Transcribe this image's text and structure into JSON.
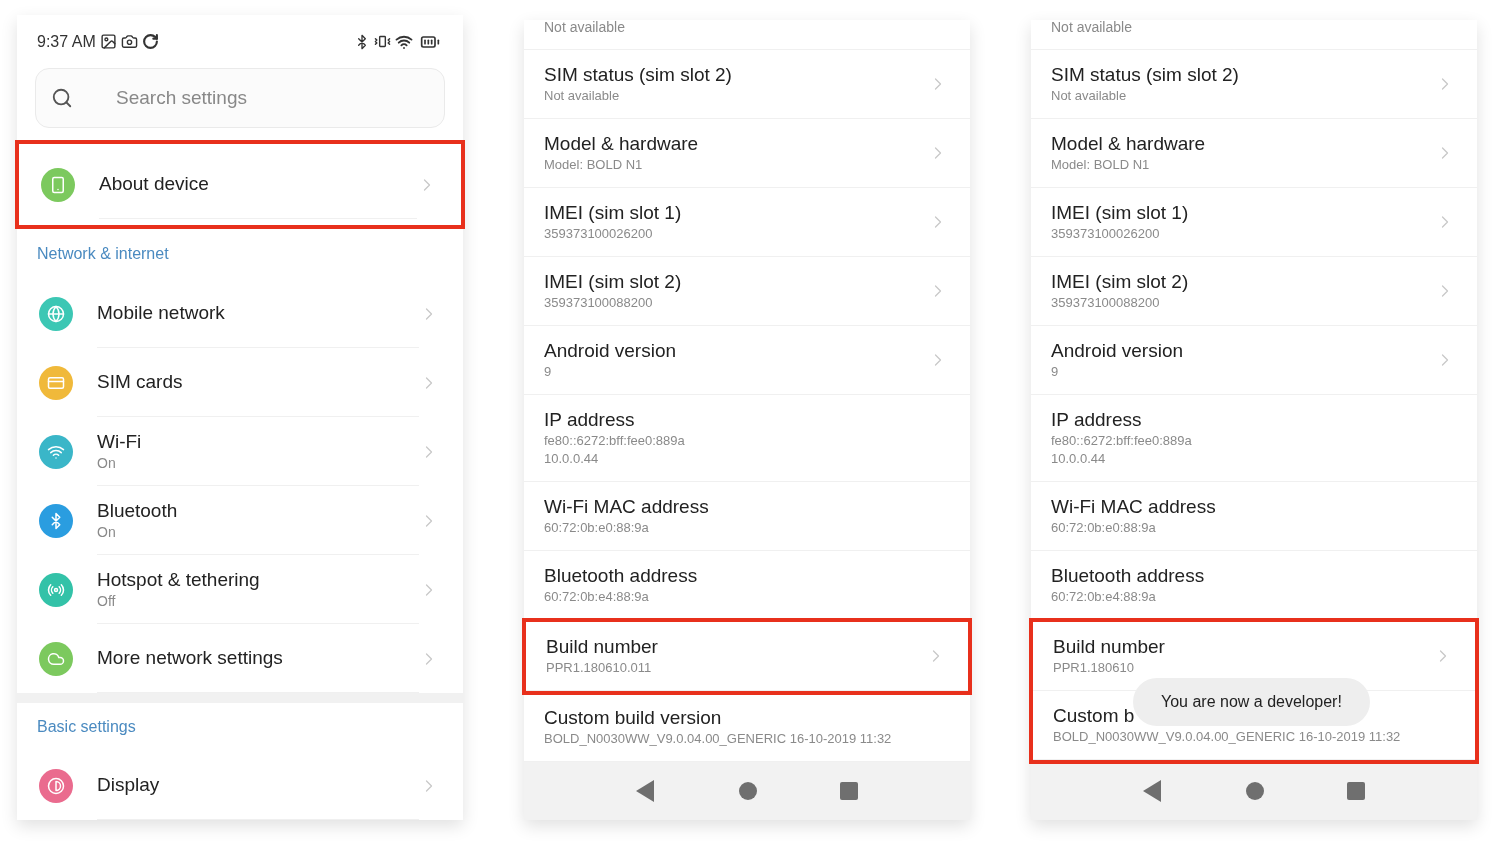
{
  "screens": [
    {
      "kind": "main",
      "status_bar": {
        "time": "9:37 AM"
      },
      "search": {
        "placeholder": "Search settings"
      },
      "sections": [
        {
          "rows": [
            {
              "title": "About device",
              "color": "#7cc95e",
              "highlighted": true
            }
          ]
        },
        {
          "header": "Network & internet",
          "rows": [
            {
              "title": "Mobile network",
              "color": "#3cc7b4",
              "highlighted": false
            },
            {
              "title": "SIM cards",
              "color": "#f0b93a",
              "highlighted": false
            },
            {
              "title": "Wi-Fi",
              "subtitle": "On",
              "color": "#3ab6c8",
              "highlighted": false
            },
            {
              "title": "Bluetooth",
              "subtitle": "On",
              "color": "#2a9de0",
              "highlighted": false
            },
            {
              "title": "Hotspot & tethering",
              "subtitle": "Off",
              "color": "#33c2a8",
              "highlighted": false
            },
            {
              "title": "More network settings",
              "color": "#7cc95e",
              "highlighted": false
            }
          ]
        },
        {
          "header": "Basic settings",
          "rows": [
            {
              "title": "Display",
              "color": "#ea6b8e",
              "highlighted": false
            }
          ]
        }
      ]
    },
    {
      "kind": "about",
      "top_value": "Not available",
      "rows": [
        {
          "title": "SIM status (sim slot 2)",
          "values": [
            "Not available"
          ],
          "chevron": true,
          "highlighted": false
        },
        {
          "title": "Model & hardware",
          "values": [
            "Model: BOLD N1"
          ],
          "chevron": true,
          "highlighted": false
        },
        {
          "title": "IMEI (sim slot 1)",
          "values": [
            "359373100026200"
          ],
          "chevron": true,
          "highlighted": false
        },
        {
          "title": "IMEI (sim slot 2)",
          "values": [
            "359373100088200"
          ],
          "chevron": true,
          "highlighted": false
        },
        {
          "title": "Android version",
          "values": [
            "9"
          ],
          "chevron": true,
          "highlighted": false
        },
        {
          "title": "IP address",
          "values": [
            "fe80::6272:bff:fee0:889a",
            "10.0.0.44"
          ],
          "chevron": false,
          "highlighted": false
        },
        {
          "title": "Wi-Fi MAC address",
          "values": [
            "60:72:0b:e0:88:9a"
          ],
          "chevron": false,
          "highlighted": false
        },
        {
          "title": "Bluetooth address",
          "values": [
            "60:72:0b:e4:88:9a"
          ],
          "chevron": false,
          "highlighted": false
        },
        {
          "title": "Build number",
          "values": [
            "PPR1.180610.011"
          ],
          "chevron": true,
          "highlighted": true
        },
        {
          "title": "Custom build version",
          "values": [
            "BOLD_N0030WW_V9.0.04.00_GENERIC 16-10-2019 11:32"
          ],
          "chevron": false,
          "highlighted": false
        }
      ]
    },
    {
      "kind": "about",
      "top_value": "Not available",
      "toast": {
        "message": "You are now a developer!"
      },
      "rows": [
        {
          "title": "SIM status (sim slot 2)",
          "values": [
            "Not available"
          ],
          "chevron": true,
          "highlighted": false
        },
        {
          "title": "Model & hardware",
          "values": [
            "Model: BOLD N1"
          ],
          "chevron": true,
          "highlighted": false
        },
        {
          "title": "IMEI (sim slot 1)",
          "values": [
            "359373100026200"
          ],
          "chevron": true,
          "highlighted": false
        },
        {
          "title": "IMEI (sim slot 2)",
          "values": [
            "359373100088200"
          ],
          "chevron": true,
          "highlighted": false
        },
        {
          "title": "Android version",
          "values": [
            "9"
          ],
          "chevron": true,
          "highlighted": false
        },
        {
          "title": "IP address",
          "values": [
            "fe80::6272:bff:fee0:889a",
            "10.0.0.44"
          ],
          "chevron": false,
          "highlighted": false
        },
        {
          "title": "Wi-Fi MAC address",
          "values": [
            "60:72:0b:e0:88:9a"
          ],
          "chevron": false,
          "highlighted": false
        },
        {
          "title": "Bluetooth address",
          "values": [
            "60:72:0b:e4:88:9a"
          ],
          "chevron": false,
          "highlighted": false
        },
        {
          "title": "Build number",
          "values": [
            "PPR1.180610"
          ],
          "chevron": true,
          "highlighted": true
        },
        {
          "title": "Custom b",
          "values": [
            "BOLD_N0030WW_V9.0.04.00_GENERIC 16-10-2019 11:32"
          ],
          "chevron": false,
          "highlighted": true
        }
      ]
    }
  ]
}
